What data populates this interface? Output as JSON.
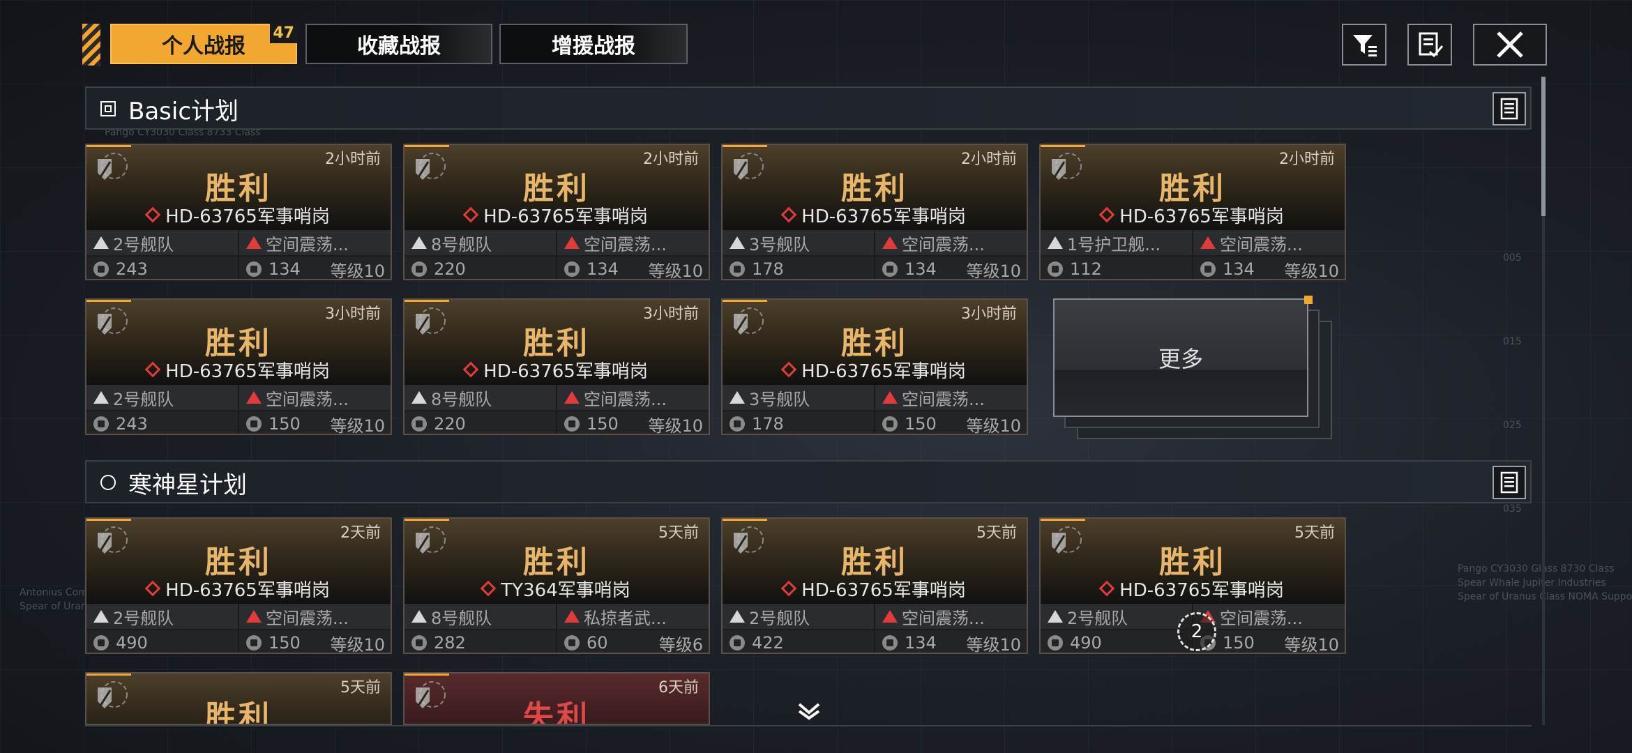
{
  "tabs": [
    {
      "label": "个人战报",
      "badge": "47",
      "active": true
    },
    {
      "label": "收藏战报",
      "active": false
    },
    {
      "label": "增援战报",
      "active": false
    }
  ],
  "toolbar": {
    "filter_icon": "filter-icon",
    "report_icon": "checklist-icon",
    "close_icon": "close-icon"
  },
  "sections": [
    {
      "title": "Basic计划",
      "mark": "square",
      "cards": [
        {
          "time": "2小时前",
          "result": "胜利",
          "target": "HD-63765军事哨岗",
          "fleet": "2号舰队",
          "enemy": "空间震荡...",
          "power": "243",
          "enemy_power": "134",
          "level": "等级10"
        },
        {
          "time": "2小时前",
          "result": "胜利",
          "target": "HD-63765军事哨岗",
          "fleet": "8号舰队",
          "enemy": "空间震荡...",
          "power": "220",
          "enemy_power": "134",
          "level": "等级10"
        },
        {
          "time": "2小时前",
          "result": "胜利",
          "target": "HD-63765军事哨岗",
          "fleet": "3号舰队",
          "enemy": "空间震荡...",
          "power": "178",
          "enemy_power": "134",
          "level": "等级10"
        },
        {
          "time": "2小时前",
          "result": "胜利",
          "target": "HD-63765军事哨岗",
          "fleet": "1号护卫舰...",
          "enemy": "空间震荡...",
          "power": "112",
          "enemy_power": "134",
          "level": "等级10"
        },
        {
          "time": "3小时前",
          "result": "胜利",
          "target": "HD-63765军事哨岗",
          "fleet": "2号舰队",
          "enemy": "空间震荡...",
          "power": "243",
          "enemy_power": "150",
          "level": "等级10"
        },
        {
          "time": "3小时前",
          "result": "胜利",
          "target": "HD-63765军事哨岗",
          "fleet": "8号舰队",
          "enemy": "空间震荡...",
          "power": "220",
          "enemy_power": "150",
          "level": "等级10"
        },
        {
          "time": "3小时前",
          "result": "胜利",
          "target": "HD-63765军事哨岗",
          "fleet": "3号舰队",
          "enemy": "空间震荡...",
          "power": "178",
          "enemy_power": "150",
          "level": "等级10"
        }
      ],
      "more_label": "更多"
    },
    {
      "title": "寒神星计划",
      "mark": "circle",
      "cards": [
        {
          "time": "2天前",
          "result": "胜利",
          "target": "HD-63765军事哨岗",
          "fleet": "2号舰队",
          "enemy": "空间震荡...",
          "power": "490",
          "enemy_power": "150",
          "level": "等级10"
        },
        {
          "time": "5天前",
          "result": "胜利",
          "target": "TY364军事哨岗",
          "fleet": "8号舰队",
          "enemy": "私掠者武...",
          "power": "282",
          "enemy_power": "60",
          "level": "等级6"
        },
        {
          "time": "5天前",
          "result": "胜利",
          "target": "HD-63765军事哨岗",
          "fleet": "2号舰队",
          "enemy": "空间震荡...",
          "power": "422",
          "enemy_power": "134",
          "level": "等级10"
        },
        {
          "time": "5天前",
          "result": "胜利",
          "target": "HD-63765军事哨岗",
          "fleet": "2号舰队",
          "enemy": "空间震荡...",
          "power": "490",
          "enemy_power": "150",
          "level": "等级10",
          "marker": "2"
        },
        {
          "time": "5天前",
          "result": "胜利"
        },
        {
          "time": "6天前",
          "result": "失利",
          "loss": true
        }
      ]
    }
  ],
  "side_text": {
    "right_ticks": [
      "005",
      "015",
      "025",
      "035"
    ],
    "right_info": "Pango CY3030 Glass 8730 Class\nSpear Whale Jupiter Industries\nSpear of Uranus Class NOMA Support",
    "left_info": "Antonius Com\nSpear of Uran",
    "hidden_line": "Pango CY3030 Class 8733 Class"
  }
}
